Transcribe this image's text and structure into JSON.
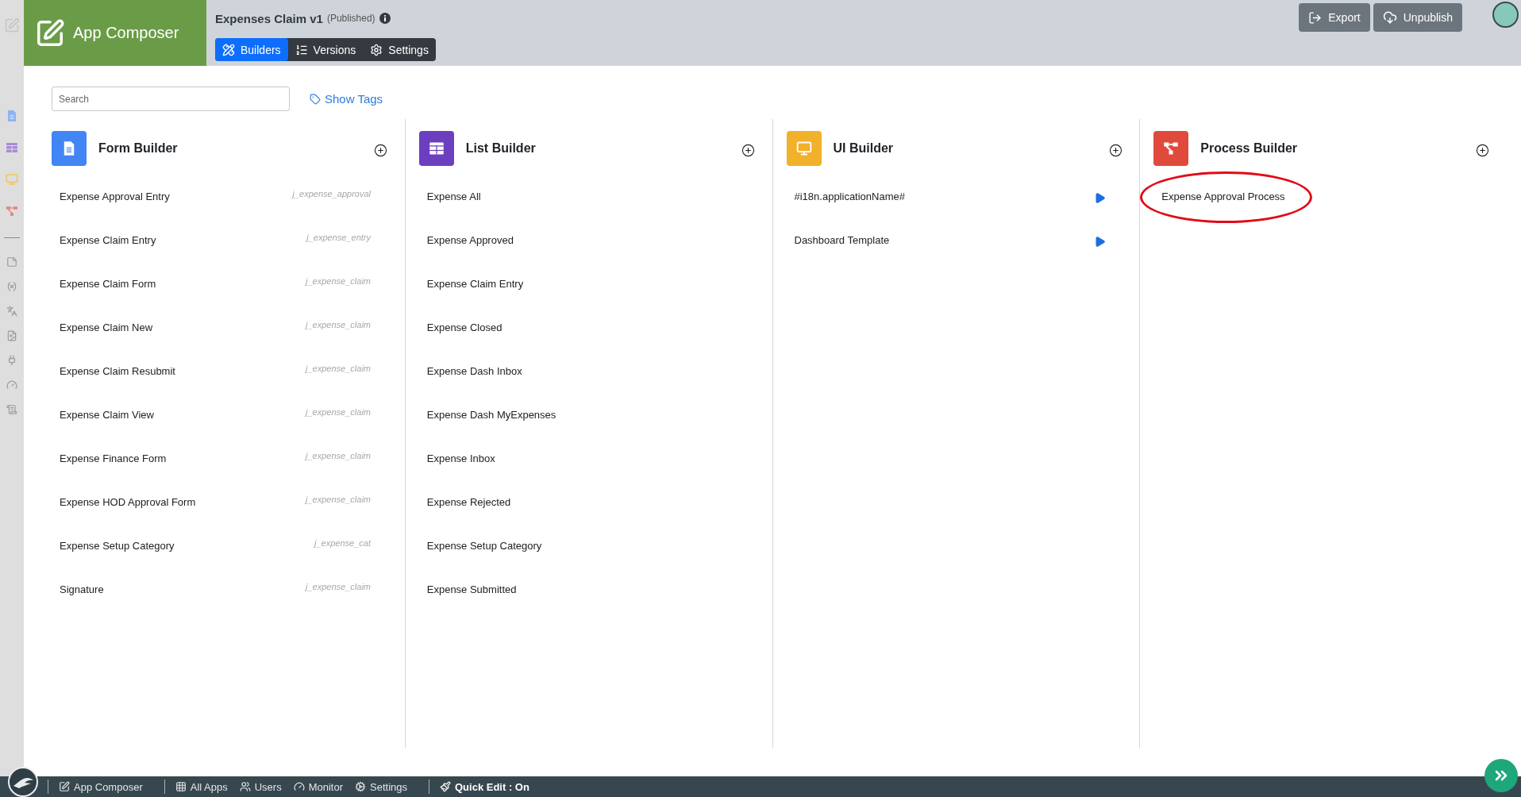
{
  "header": {
    "brand": "App Composer",
    "app_title": "Expenses Claim v1",
    "status": "(Published)",
    "tabs": [
      {
        "kind": "builders",
        "label": "Builders",
        "selected": true
      },
      {
        "kind": "versions",
        "label": "Versions",
        "selected": false
      },
      {
        "kind": "settings",
        "label": "Settings",
        "selected": false
      }
    ],
    "actions": [
      {
        "kind": "export",
        "label": "Export"
      },
      {
        "kind": "unpublish",
        "label": "Unpublish"
      }
    ]
  },
  "toolbar": {
    "search": {
      "placeholder": "Search"
    },
    "show_tags": "Show Tags"
  },
  "builders": [
    {
      "kind": "form",
      "title": "Form Builder",
      "items": [
        {
          "label": "Expense Approval Entry",
          "tag": "j_expense_approval"
        },
        {
          "label": "Expense Claim Entry",
          "tag": "j_expense_entry"
        },
        {
          "label": "Expense Claim Form",
          "tag": "j_expense_claim"
        },
        {
          "label": "Expense Claim New",
          "tag": "j_expense_claim"
        },
        {
          "label": "Expense Claim Resubmit",
          "tag": "j_expense_claim"
        },
        {
          "label": "Expense Claim View",
          "tag": "j_expense_claim"
        },
        {
          "label": "Expense Finance Form",
          "tag": "j_expense_claim"
        },
        {
          "label": "Expense HOD Approval Form",
          "tag": "j_expense_claim"
        },
        {
          "label": "Expense Setup Category",
          "tag": "j_expense_cat"
        },
        {
          "label": "Signature",
          "tag": "j_expense_claim"
        }
      ]
    },
    {
      "kind": "list",
      "title": "List Builder",
      "items": [
        {
          "label": "Expense All"
        },
        {
          "label": "Expense Approved"
        },
        {
          "label": "Expense Claim Entry"
        },
        {
          "label": "Expense Closed"
        },
        {
          "label": "Expense Dash Inbox"
        },
        {
          "label": "Expense Dash MyExpenses"
        },
        {
          "label": "Expense Inbox"
        },
        {
          "label": "Expense Rejected"
        },
        {
          "label": "Expense Setup Category"
        },
        {
          "label": "Expense Submitted"
        }
      ]
    },
    {
      "kind": "ui",
      "title": "UI Builder",
      "items": [
        {
          "label": "#i18n.applicationName#"
        },
        {
          "label": "Dashboard Template"
        }
      ]
    },
    {
      "kind": "process",
      "title": "Process Builder",
      "items": [
        {
          "label": "Expense Approval Process",
          "circled": true
        }
      ]
    }
  ],
  "footer": {
    "groups": [
      {
        "items": [
          {
            "kind": "composer",
            "label": "App Composer"
          }
        ]
      },
      {
        "items": [
          {
            "kind": "apps",
            "label": "All Apps"
          },
          {
            "kind": "users",
            "label": "Users"
          },
          {
            "kind": "monitor",
            "label": "Monitor"
          },
          {
            "kind": "settings",
            "label": "Settings"
          }
        ]
      },
      {
        "items": [
          {
            "kind": "quickedit",
            "label": "Quick Edit : On"
          }
        ]
      }
    ]
  }
}
